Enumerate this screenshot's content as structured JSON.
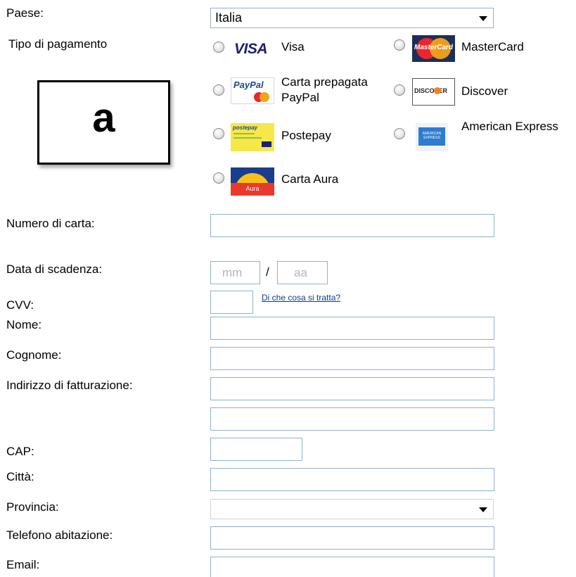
{
  "country": {
    "label": "Paese:",
    "value": "Italia"
  },
  "payment": {
    "label": "Tipo di pagamento",
    "badge_letter": "a",
    "options": [
      {
        "name": "Visa",
        "logo": "visa-logo",
        "logo_text": "VISA"
      },
      {
        "name": "MasterCard",
        "logo": "mastercard-logo",
        "logo_text": "MasterCard"
      },
      {
        "name_line1": "Carta prepagata",
        "name_line2": "PayPal",
        "logo": "paypal-logo",
        "logo_text": "PayPal"
      },
      {
        "name": "Discover",
        "logo": "discover-logo",
        "logo_text": "DISCOVER"
      },
      {
        "name": "Postepay",
        "logo": "postepay-logo",
        "logo_text": "postepay"
      },
      {
        "name": "American Express",
        "logo": "amex-logo",
        "logo_text": "AMERICAN EXPRESS"
      },
      {
        "name": "Carta Aura",
        "logo": "aura-logo",
        "logo_text": "Aura"
      }
    ]
  },
  "form": {
    "card_number": {
      "label": "Numero di carta:"
    },
    "expiry": {
      "label": "Data di scadenza:",
      "month_placeholder": "mm",
      "separator": "/",
      "year_placeholder": "aa"
    },
    "cvv": {
      "label": "CVV:",
      "help_link": "Di che cosa si tratta?"
    },
    "first_name": {
      "label": "Nome:"
    },
    "last_name": {
      "label": "Cognome:"
    },
    "billing_address": {
      "label": "Indirizzo di fatturazione:"
    },
    "zip": {
      "label": "CAP:"
    },
    "city": {
      "label": "Città:"
    },
    "province": {
      "label": "Provincia:",
      "value": ""
    },
    "home_phone": {
      "label": "Telefono abitazione:"
    },
    "email": {
      "label": "Email:"
    }
  },
  "colors": {
    "field_border": "#8fb1cf",
    "link": "#0b3d91",
    "visa_blue": "#1a1f71"
  }
}
